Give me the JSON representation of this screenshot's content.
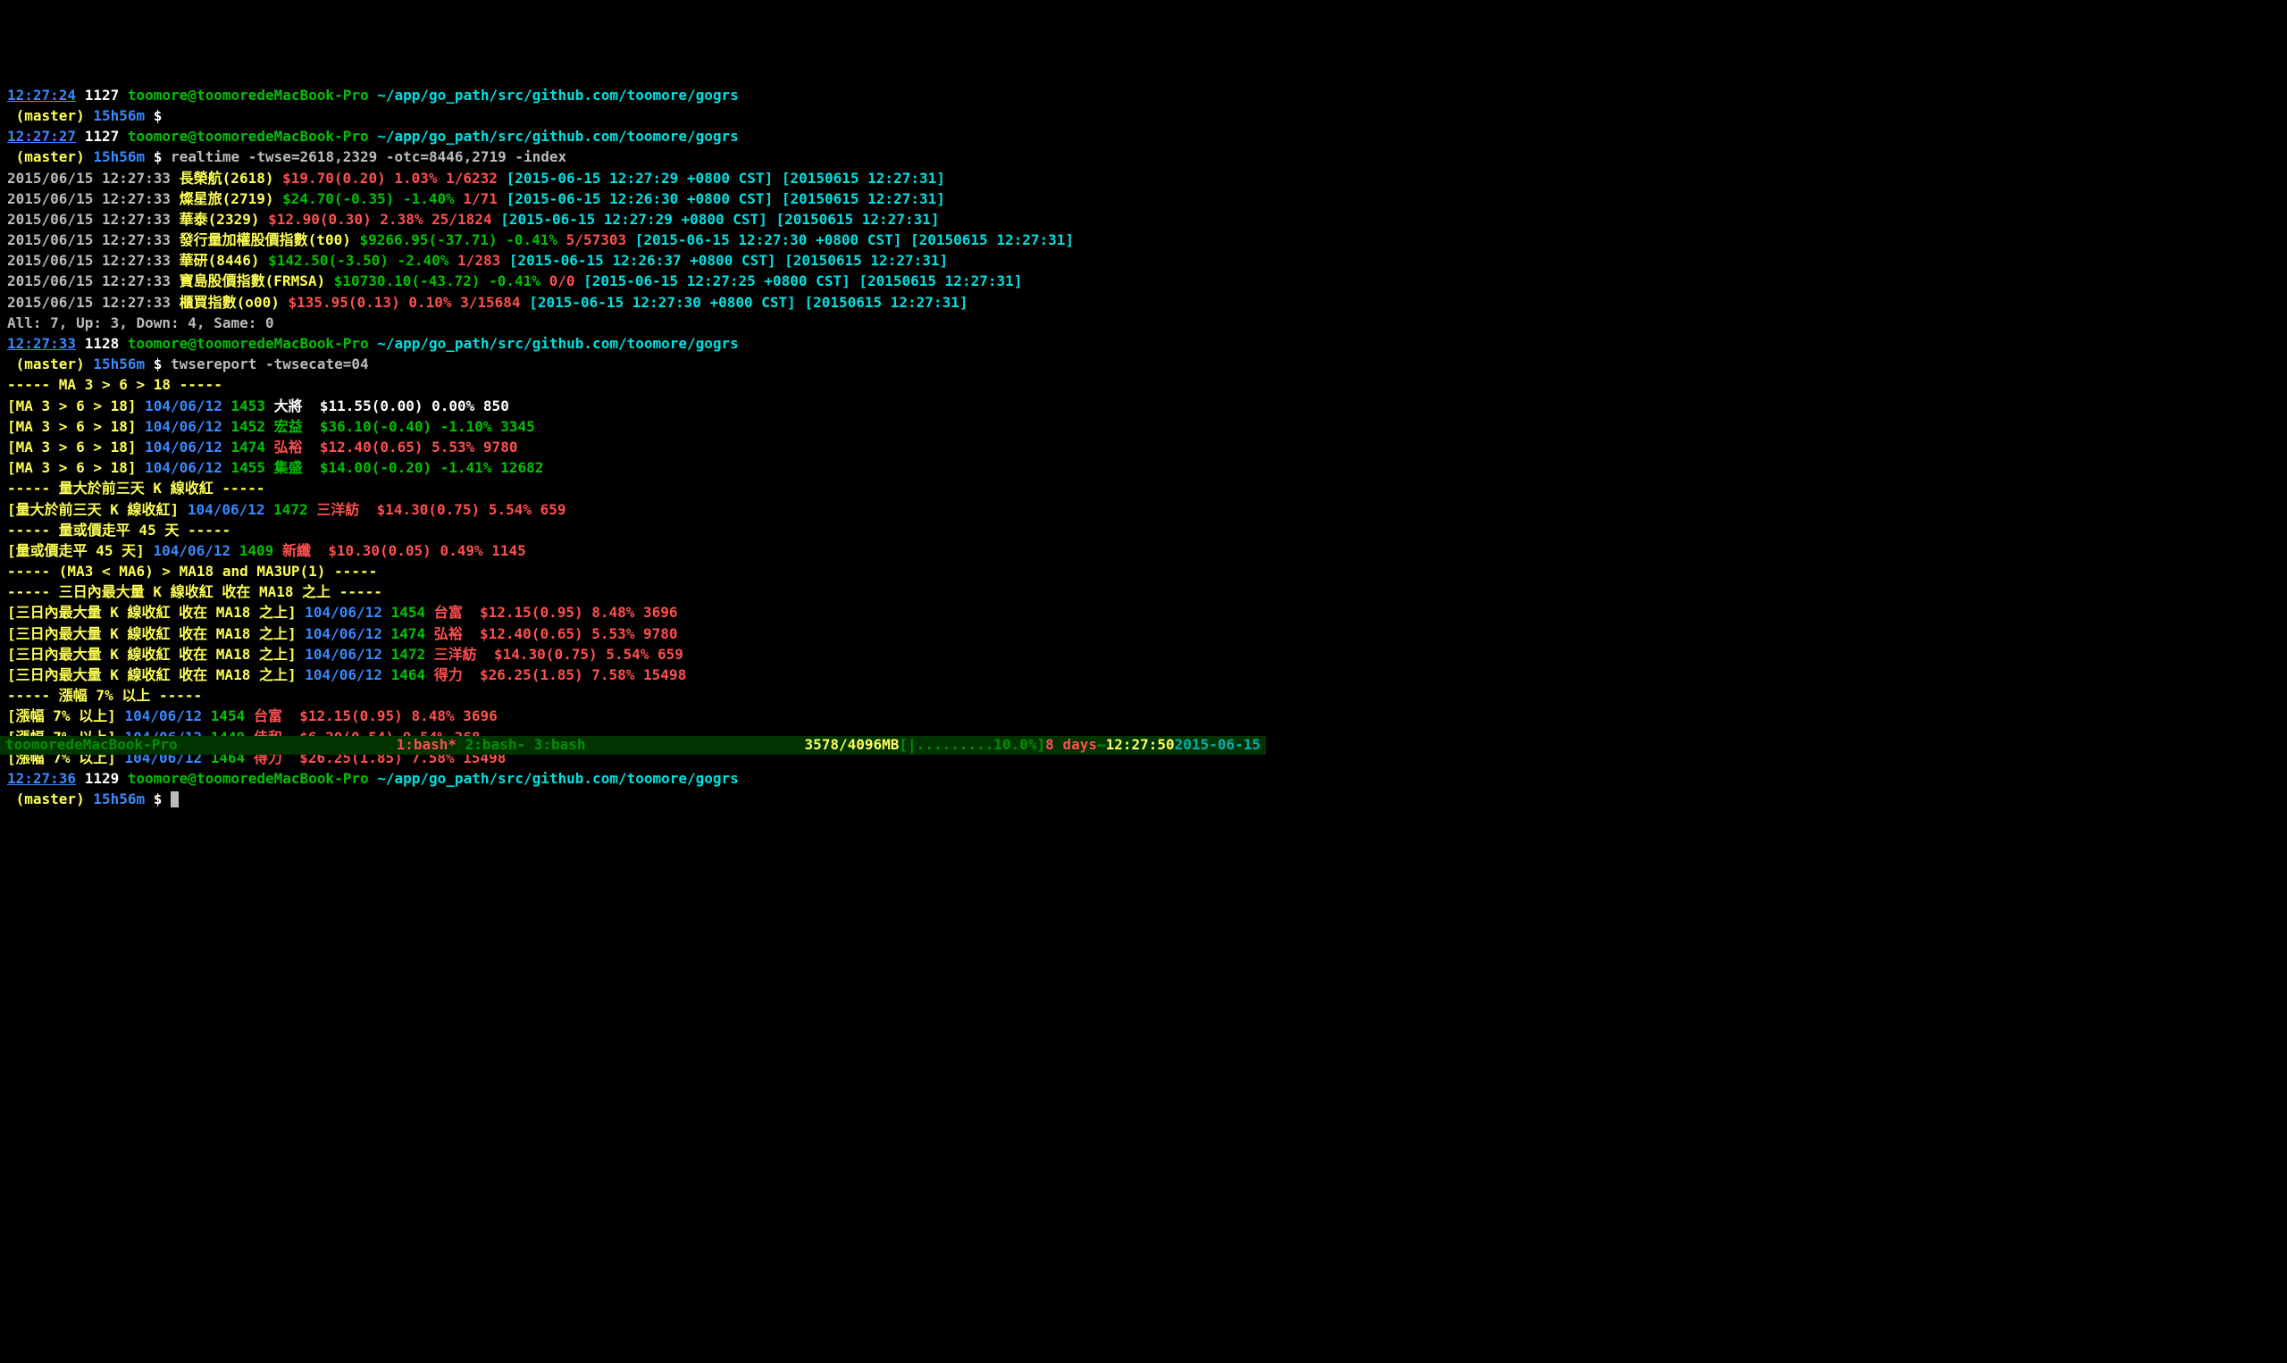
{
  "prompts": [
    {
      "time": "12:27:24",
      "hist": "1127",
      "userhost": "toomore@toomoredeMacBook-Pro",
      "cwd": "~/app/go_path/src/github.com/toomore/gogrs",
      "branch": "(master)",
      "age": "15h56m",
      "cmd": ""
    },
    {
      "time": "12:27:27",
      "hist": "1127",
      "userhost": "toomore@toomoredeMacBook-Pro",
      "cwd": "~/app/go_path/src/github.com/toomore/gogrs",
      "branch": "(master)",
      "age": "15h56m",
      "cmd": "realtime -twse=2618,2329 -otc=8446,2719 -index"
    },
    {
      "time": "12:27:33",
      "hist": "1128",
      "userhost": "toomore@toomoredeMacBook-Pro",
      "cwd": "~/app/go_path/src/github.com/toomore/gogrs",
      "branch": "(master)",
      "age": "15h56m",
      "cmd": "twsereport -twsecate=04"
    },
    {
      "time": "12:27:36",
      "hist": "1129",
      "userhost": "toomore@toomoredeMacBook-Pro",
      "cwd": "~/app/go_path/src/github.com/toomore/gogrs",
      "branch": "(master)",
      "age": "15h56m",
      "cmd": ""
    }
  ],
  "realtime": [
    {
      "ts": "2015/06/15 12:27:33",
      "name": "長榮航",
      "code": "(2618)",
      "price": "$19.70(0.20)",
      "pct": "1.03%",
      "pct_color": "red",
      "vol": "1/6232",
      "meta1": "[2015-06-15 12:27:29 +0800 CST]",
      "meta2": "[20150615 12:27:31]"
    },
    {
      "ts": "2015/06/15 12:27:33",
      "name": "燦星旅",
      "code": "(2719)",
      "price": "$24.70(-0.35)",
      "pct": "-1.40%",
      "pct_color": "green",
      "vol": "1/71",
      "meta1": "[2015-06-15 12:26:30 +0800 CST]",
      "meta2": "[20150615 12:27:31]"
    },
    {
      "ts": "2015/06/15 12:27:33",
      "name": "華泰",
      "code": "(2329)",
      "price": "$12.90(0.30)",
      "pct": "2.38%",
      "pct_color": "red",
      "vol": "25/1824",
      "meta1": "[2015-06-15 12:27:29 +0800 CST]",
      "meta2": "[20150615 12:27:31]"
    },
    {
      "ts": "2015/06/15 12:27:33",
      "name": "發行量加權股價指數",
      "code": "(t00)",
      "price": "$9266.95(-37.71)",
      "pct": "-0.41%",
      "pct_color": "green",
      "vol": "5/57303",
      "meta1": "[2015-06-15 12:27:30 +0800 CST]",
      "meta2": "[20150615 12:27:31]"
    },
    {
      "ts": "2015/06/15 12:27:33",
      "name": "華研",
      "code": "(8446)",
      "price": "$142.50(-3.50)",
      "pct": "-2.40%",
      "pct_color": "green",
      "vol": "1/283",
      "meta1": "[2015-06-15 12:26:37 +0800 CST]",
      "meta2": "[20150615 12:27:31]"
    },
    {
      "ts": "2015/06/15 12:27:33",
      "name": "寶島股價指數",
      "code": "(FRMSA)",
      "price": "$10730.10(-43.72)",
      "pct": "-0.41%",
      "pct_color": "green",
      "vol": "0/0",
      "meta1": "[2015-06-15 12:27:25 +0800 CST]",
      "meta2": "[20150615 12:27:31]"
    },
    {
      "ts": "2015/06/15 12:27:33",
      "name": "櫃買指數",
      "code": "(o00)",
      "price": "$135.95(0.13)",
      "pct": "0.10%",
      "pct_color": "red",
      "vol": "3/15684",
      "meta1": "[2015-06-15 12:27:30 +0800 CST]",
      "meta2": "[20150615 12:27:31]"
    }
  ],
  "realtime_summary": "All: 7, Up: 3, Down: 4, Same: 0",
  "report": {
    "groups": [
      {
        "header": "----- MA 3 > 6 > 18 -----",
        "tag": "[MA 3 > 6 > 18]",
        "rows": [
          {
            "date": "104/06/12",
            "code": "1453",
            "name": "大將",
            "price": "$11.55(0.00)",
            "pct": "0.00%",
            "vol": "850",
            "color": "white"
          },
          {
            "date": "104/06/12",
            "code": "1452",
            "name": "宏益",
            "price": "$36.10(-0.40)",
            "pct": "-1.10%",
            "vol": "3345",
            "color": "green"
          },
          {
            "date": "104/06/12",
            "code": "1474",
            "name": "弘裕",
            "price": "$12.40(0.65)",
            "pct": "5.53%",
            "vol": "9780",
            "color": "red"
          },
          {
            "date": "104/06/12",
            "code": "1455",
            "name": "集盛",
            "price": "$14.00(-0.20)",
            "pct": "-1.41%",
            "vol": "12682",
            "color": "green"
          }
        ]
      },
      {
        "header": "----- 量大於前三天 K 線收紅 -----",
        "tag": "[量大於前三天 K 線收紅]",
        "rows": [
          {
            "date": "104/06/12",
            "code": "1472",
            "name": "三洋紡",
            "price": "$14.30(0.75)",
            "pct": "5.54%",
            "vol": "659",
            "color": "red"
          }
        ]
      },
      {
        "header": "----- 量或價走平 45 天 -----",
        "tag": "[量或價走平 45 天]",
        "rows": [
          {
            "date": "104/06/12",
            "code": "1409",
            "name": "新纖",
            "price": "$10.30(0.05)",
            "pct": "0.49%",
            "vol": "1145",
            "color": "red"
          }
        ]
      },
      {
        "header": "----- (MA3 < MA6) > MA18 and MA3UP(1) -----",
        "tag": "",
        "rows": []
      },
      {
        "header": "----- 三日內最大量 K 線收紅 收在 MA18 之上 -----",
        "tag": "[三日內最大量 K 線收紅 收在 MA18 之上]",
        "rows": [
          {
            "date": "104/06/12",
            "code": "1454",
            "name": "台富",
            "price": "$12.15(0.95)",
            "pct": "8.48%",
            "vol": "3696",
            "color": "red"
          },
          {
            "date": "104/06/12",
            "code": "1474",
            "name": "弘裕",
            "price": "$12.40(0.65)",
            "pct": "5.53%",
            "vol": "9780",
            "color": "red"
          },
          {
            "date": "104/06/12",
            "code": "1472",
            "name": "三洋紡",
            "price": "$14.30(0.75)",
            "pct": "5.54%",
            "vol": "659",
            "color": "red"
          },
          {
            "date": "104/06/12",
            "code": "1464",
            "name": "得力",
            "price": "$26.25(1.85)",
            "pct": "7.58%",
            "vol": "15498",
            "color": "red"
          }
        ]
      },
      {
        "header": "----- 漲幅 7% 以上 -----",
        "tag": "[漲幅 7% 以上]",
        "rows": [
          {
            "date": "104/06/12",
            "code": "1454",
            "name": "台富",
            "price": "$12.15(0.95)",
            "pct": "8.48%",
            "vol": "3696",
            "color": "red"
          },
          {
            "date": "104/06/12",
            "code": "1449",
            "name": "佳和",
            "price": "$6.20(0.54)",
            "pct": "9.54%",
            "vol": "268",
            "color": "red"
          },
          {
            "date": "104/06/12",
            "code": "1464",
            "name": "得力",
            "price": "$26.25(1.85)",
            "pct": "7.58%",
            "vol": "15498",
            "color": "red"
          }
        ]
      }
    ]
  },
  "statusbar": {
    "host": "toomoredeMacBook-Pro",
    "tabs": "1:bash* 2:bash- 3:bash",
    "tab_active": "1:bash*",
    "tab_rest": " 2:bash- 3:bash",
    "mem": "3578/4096MB",
    "bar": "[|.........10.0%]",
    "uptime": "8 days",
    "sep": "—",
    "clock": "12:27:50",
    "date": "2015-06-15"
  }
}
